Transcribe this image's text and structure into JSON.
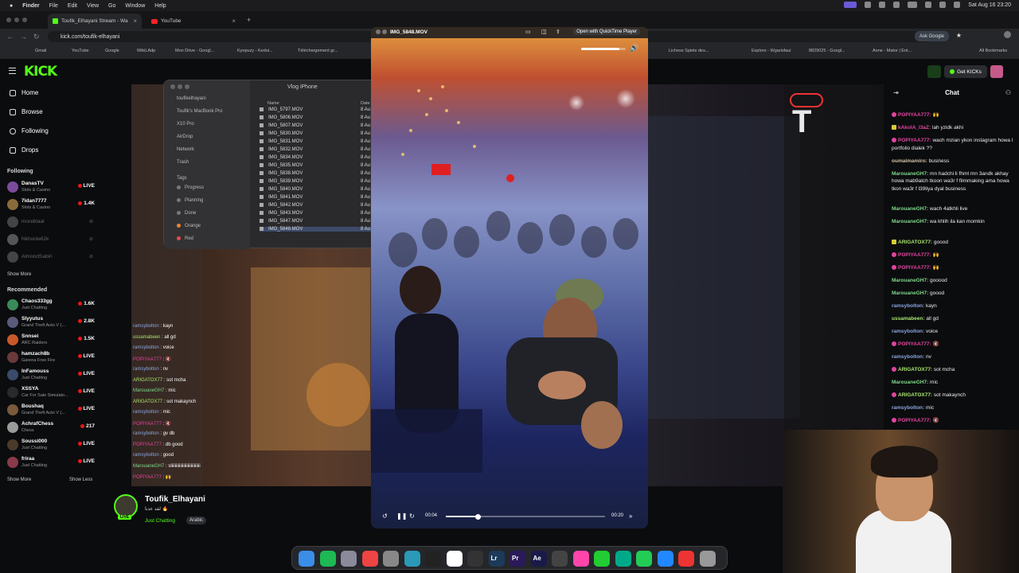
{
  "menubar": {
    "apple": "",
    "items": [
      "Finder",
      "File",
      "Edit",
      "View",
      "Go",
      "Window",
      "Help"
    ],
    "datetime": "Sat Aug 16 23:20"
  },
  "browser": {
    "tabs": [
      {
        "label": "Toufik_Elhayani Stream - Wa",
        "active": true
      },
      {
        "label": "YouTube",
        "active": false
      }
    ],
    "url": "kick.com/toufik-elhayani",
    "ask_google": "Ask Google",
    "bookmarks": [
      "Gmail",
      "YouTube",
      "Google",
      "WikiLAdp",
      "Mon Drive - Googl...",
      "Kyopuzy - Kedui...",
      "Téléchargement gr...",
      "Lichess Spiele des...",
      "Explore - Wgarisfaui",
      "8829025 - Googl...",
      "Aone - Mator | Ent...",
      "All Bookmarks"
    ],
    "nav": {
      "back": "←",
      "forward": "→",
      "reload": "↻"
    }
  },
  "kick": {
    "logo": "KICK",
    "get_kicks": "Get KICKs",
    "nav": [
      {
        "label": "Home",
        "icon": "home-icon"
      },
      {
        "label": "Browse",
        "icon": "browse-icon"
      },
      {
        "label": "Following",
        "icon": "heart-icon"
      },
      {
        "label": "Drops",
        "icon": "drops-icon"
      }
    ],
    "following_title": "Following",
    "following": [
      {
        "name": "DanasTV",
        "cat": "Slots & Casino",
        "status": "LIVE",
        "color": "#7a4b9a"
      },
      {
        "name": "7idan7777",
        "cat": "Slots & Casino",
        "status": "1.4K",
        "color": "#8a6a3a"
      },
      {
        "name": "moreblaal",
        "cat": "",
        "status": "",
        "color": "#444",
        "off": true
      },
      {
        "name": "Nkhoole62k",
        "cat": "",
        "status": "",
        "color": "#555",
        "off": true
      },
      {
        "name": "AlmondSabiri",
        "cat": "",
        "status": "",
        "color": "#444",
        "off": true
      }
    ],
    "show_more": "Show More",
    "recommended_title": "Recommended",
    "recommended": [
      {
        "name": "Chaos333gg",
        "cat": "Just Chatting",
        "status": "1.6K",
        "color": "#3a8a5a"
      },
      {
        "name": "Slyyutus",
        "cat": "Grand Theft Auto V (...",
        "status": "2.8K",
        "color": "#5a5a7a"
      },
      {
        "name": "Snnsei",
        "cat": "ARC Raiders",
        "status": "1.5K",
        "color": "#c8582a"
      },
      {
        "name": "hamzach8b",
        "cat": "Garena Free Fire",
        "status": "LIVE",
        "color": "#6a3a3a"
      },
      {
        "name": "InFamouss",
        "cat": "Just Chatting",
        "status": "LIVE",
        "color": "#3a4a6a"
      },
      {
        "name": "XSSYA",
        "cat": "Car For Sale Simulato...",
        "status": "LIVE",
        "color": "#2a2a2a"
      },
      {
        "name": "Boushaq",
        "cat": "Grand Theft Auto V (...",
        "status": "LIVE",
        "color": "#7a5a3a"
      },
      {
        "name": "AchrafChess",
        "cat": "Chess",
        "status": "217",
        "color": "#9a9a9a"
      },
      {
        "name": "Soussi000",
        "cat": "Just Chatting",
        "status": "LIVE",
        "color": "#4a3a2a"
      },
      {
        "name": "friraa",
        "cat": "Just Chatting",
        "status": "LIVE",
        "color": "#8a3a4a"
      }
    ],
    "show_more2": "Show More",
    "show_less": "Show Less",
    "streamer": {
      "name": "Toufik_Elhayani",
      "title": "لقد عدنا 🔥",
      "category": "Just Chatting",
      "tag": "Arabic",
      "live": "LIVE"
    },
    "chat_title": "Chat",
    "chat": [
      {
        "user": "POPIYAA777:",
        "msg": "🙌",
        "color": "#e0459e",
        "badge": "pink"
      },
      {
        "user": "kAkolA_l3aZ:",
        "msg": "lah yzidk akhi",
        "color": "#e0459e",
        "badge": "yellow"
      },
      {
        "user": "POPIYAA777:",
        "msg": "wach mzian ykon instagram howa l portfolio dialek ??",
        "color": "#e0459e",
        "badge": "pink"
      },
      {
        "user": "oumaimamiro:",
        "msg": "business",
        "color": "#d5c3a8",
        "badge": ""
      },
      {
        "user": "MarouaneGH7:",
        "msg": "mn hadchi li fhmt mn 3andk akhay howa mab9atch tkoon wa3r f filmmaking ama howa tkon wa3r f l39liya dyal business",
        "color": "#7fd88a",
        "badge": ""
      },
      {
        "user": "MarouaneGH7:",
        "msg": "wach 4atkhli live",
        "color": "#7fd88a",
        "badge": ""
      },
      {
        "user": "MarouaneGH7:",
        "msg": "wa khlih ila kan momkin",
        "color": "#7fd88a",
        "badge": ""
      },
      {
        "user": "ARIGATOX77:",
        "msg": "goood",
        "color": "#a7e36d",
        "badge": "yellow"
      },
      {
        "user": "POPIYAA777:",
        "msg": "🙌",
        "color": "#e0459e",
        "badge": "pink"
      },
      {
        "user": "POPIYAA777:",
        "msg": "🙌",
        "color": "#e0459e",
        "badge": "pink"
      },
      {
        "user": "MarouaneGH7:",
        "msg": "gooood",
        "color": "#7fd88a",
        "badge": ""
      },
      {
        "user": "MarouaneGH7:",
        "msg": "goood",
        "color": "#7fd88a",
        "badge": ""
      },
      {
        "user": "ramsybolton:",
        "msg": "kayn",
        "color": "#8aa6e0",
        "badge": ""
      },
      {
        "user": "ussamabeen:",
        "msg": "all gd",
        "color": "#a7e36d",
        "badge": ""
      },
      {
        "user": "ramsybolton:",
        "msg": "voice",
        "color": "#8aa6e0",
        "badge": ""
      },
      {
        "user": "POPIYAA777:",
        "msg": "🔇",
        "color": "#e0459e",
        "badge": "pink"
      },
      {
        "user": "ramsybolton:",
        "msg": "nv",
        "color": "#8aa6e0",
        "badge": ""
      },
      {
        "user": "ARIGATOX77:",
        "msg": "sot mcha",
        "color": "#a7e36d",
        "badge": "pink"
      },
      {
        "user": "MarouaneGH7:",
        "msg": "mic",
        "color": "#7fd88a",
        "badge": ""
      },
      {
        "user": "ARIGATOX77:",
        "msg": "sot makaynch",
        "color": "#a7e36d",
        "badge": "pink"
      },
      {
        "user": "ramsybolton:",
        "msg": "mic",
        "color": "#8aa6e0",
        "badge": ""
      },
      {
        "user": "POPIYAA777:",
        "msg": "🔇",
        "color": "#e0459e",
        "badge": "pink"
      },
      {
        "user": "ramsybolton:",
        "msg": "gv db",
        "color": "#8aa6e0",
        "badge": ""
      }
    ]
  },
  "finder": {
    "title": "Vlog iPhone",
    "sidebar": [
      {
        "label": "toufikelhayani"
      },
      {
        "label": "Toufik's MacBook Pro"
      },
      {
        "label": "X10 Pro"
      },
      {
        "label": "AirDrop"
      },
      {
        "label": "Network"
      },
      {
        "label": "Trash"
      },
      {
        "label": "Tags"
      },
      {
        "label": "Progress",
        "color": "#777"
      },
      {
        "label": "Planning",
        "color": "#777"
      },
      {
        "label": "Done",
        "color": "#777"
      },
      {
        "label": "Orange",
        "color": "#e8843a"
      },
      {
        "label": "Red",
        "color": "#e84a4a"
      }
    ],
    "col_name": "Name",
    "col_date": "Date",
    "files": [
      "IMG_5797.MOV",
      "IMG_5806.MOV",
      "IMG_5807.MOV",
      "IMG_5830.MOV",
      "IMG_5831.MOV",
      "IMG_5832.MOV",
      "IMG_5834.MOV",
      "IMG_5835.MOV",
      "IMG_5838.MOV",
      "IMG_5839.MOV",
      "IMG_5840.MOV",
      "IMG_5841.MOV",
      "IMG_5842.MOV",
      "IMG_5843.MOV",
      "IMG_5847.MOV",
      "IMG_5848.MOV"
    ],
    "date_prefix": "8 Au"
  },
  "overlay_chat": [
    {
      "user": "ramsybolton",
      "msg": ": kayn",
      "color": "#8aa6e0"
    },
    {
      "user": "ussamabeen",
      "msg": ": all gd",
      "color": "#a7e36d"
    },
    {
      "user": "ramsybolton",
      "msg": ": voice",
      "color": "#8aa6e0"
    },
    {
      "user": "POPIYAA777",
      "msg": ": 🔇",
      "color": "#e0459e"
    },
    {
      "user": "ramsybolton",
      "msg": ": nv",
      "color": "#8aa6e0"
    },
    {
      "user": "ARIGATOX77",
      "msg": ": sot mcha",
      "color": "#a7e36d"
    },
    {
      "user": "MarouaneGH7",
      "msg": ": mic",
      "color": "#7fd88a"
    },
    {
      "user": "ARIGATOX77",
      "msg": ": sot makaynch",
      "color": "#a7e36d"
    },
    {
      "user": "ramsybolton",
      "msg": ": mic",
      "color": "#8aa6e0"
    },
    {
      "user": "POPIYAA777",
      "msg": ": 🔇",
      "color": "#e0459e"
    },
    {
      "user": "ramsybolton",
      "msg": ": gv db",
      "color": "#8aa6e0"
    },
    {
      "user": "POPIYAA777",
      "msg": ": db good",
      "color": "#e0459e"
    },
    {
      "user": "ramsybolton",
      "msg": ": good",
      "color": "#8aa6e0"
    },
    {
      "user": "MarouaneGH7",
      "msg": ": sliiiiiiiiiiiiiiiiiiiiiiiiiii",
      "color": "#7fd88a"
    },
    {
      "user": "POPIYAA777",
      "msg": ": 🙌",
      "color": "#e0459e"
    }
  ],
  "video": {
    "title": "IMG_5848.MOV",
    "open_btn": "Open with QuickTime Player",
    "elapsed": "00:04",
    "remaining": "00:20",
    "progress": 0.2,
    "volume": 0.86
  },
  "dock": [
    {
      "name": "finder",
      "color": "#3a8ee8"
    },
    {
      "name": "spotify",
      "color": "#1db954"
    },
    {
      "name": "launchpad",
      "color": "#8a8a9a"
    },
    {
      "name": "chrome",
      "color": "#e44"
    },
    {
      "name": "settings",
      "color": "#888"
    },
    {
      "name": "activity",
      "color": "#2a9ab8"
    },
    {
      "name": "chatgpt",
      "color": "#222"
    },
    {
      "name": "calendar",
      "color": "#fff"
    },
    {
      "name": "clock",
      "color": "#333"
    },
    {
      "name": "lightroom",
      "color": "#1c3a5a",
      "text": "Lr"
    },
    {
      "name": "premiere",
      "color": "#2a1a5a",
      "text": "Pr"
    },
    {
      "name": "after-effects",
      "color": "#1a1a4a",
      "text": "Ae"
    },
    {
      "name": "davinci",
      "color": "#444"
    },
    {
      "name": "photos",
      "color": "#f4a"
    },
    {
      "name": "facetime",
      "color": "#2c3"
    },
    {
      "name": "chatgpt2",
      "color": "#0a8"
    },
    {
      "name": "whatsapp",
      "color": "#2c5"
    },
    {
      "name": "app-store",
      "color": "#28f"
    },
    {
      "name": "screen-record",
      "color": "#e33"
    },
    {
      "name": "trash",
      "color": "#999"
    }
  ]
}
